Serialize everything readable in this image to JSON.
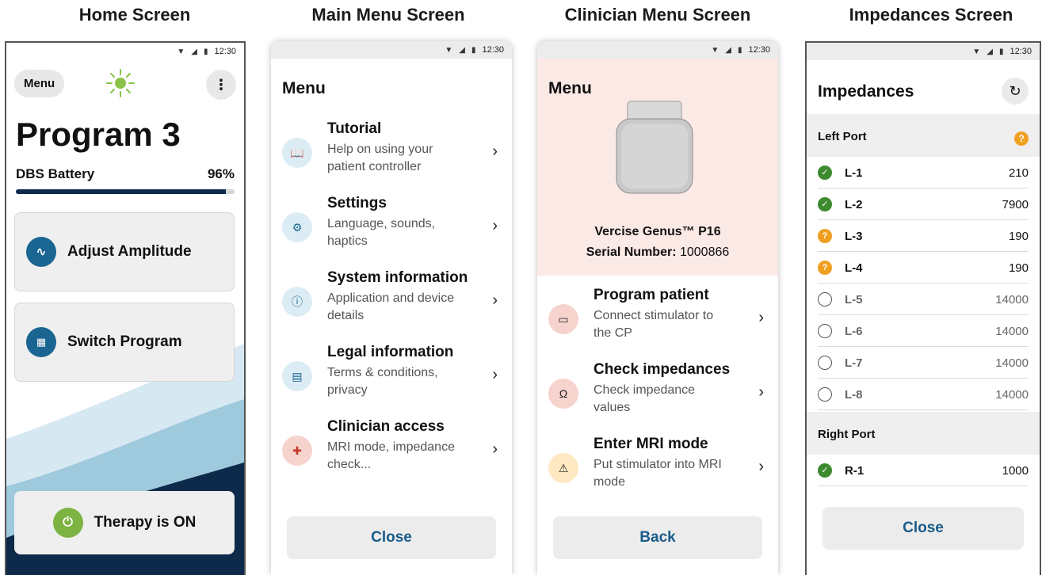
{
  "screen_titles": [
    "Home Screen",
    "Main Menu Screen",
    "Clinician Menu Screen",
    "Impedances Screen"
  ],
  "status_time": "12:30",
  "home": {
    "menu_button": "Menu",
    "kebab": "⋮",
    "program_name": "Program 3",
    "battery_label": "DBS Battery",
    "battery_percent": "96%",
    "battery_level": 0.96,
    "adjust_amplitude": "Adjust Amplitude",
    "switch_program": "Switch Program",
    "therapy_status": "Therapy is ON"
  },
  "main_menu": {
    "heading": "Menu",
    "items": [
      {
        "title": "Tutorial",
        "desc": "Help on using your patient controller",
        "icon": "book-icon"
      },
      {
        "title": "Settings",
        "desc": "Language, sounds, haptics",
        "icon": "gear-icon"
      },
      {
        "title": "System information",
        "desc": "Application and device details",
        "icon": "info-icon"
      },
      {
        "title": "Legal information",
        "desc": "Terms & conditions, privacy",
        "icon": "document-icon"
      },
      {
        "title": "Clinician access",
        "desc": "MRI mode, impedance check...",
        "icon": "medical-icon"
      }
    ],
    "close_label": "Close"
  },
  "clinician_menu": {
    "heading": "Menu",
    "device_name": "Vercise Genus™ P16",
    "serial_label": "Serial Number:",
    "serial_value": "1000866",
    "items": [
      {
        "title": "Program patient",
        "desc": "Connect stimulator to the CP",
        "icon": "laptop-icon"
      },
      {
        "title": "Check impedances",
        "desc": "Check impedance values",
        "icon": "impedance-icon"
      },
      {
        "title": "Enter MRI mode",
        "desc": "Put stimulator into MRI mode",
        "icon": "mri-warning-icon"
      }
    ],
    "back_label": "Back"
  },
  "impedances": {
    "title": "Impedances",
    "left_port": "Left Port",
    "right_port": "Right Port",
    "left_rows": [
      {
        "name": "L-1",
        "value": "210",
        "status": "ok"
      },
      {
        "name": "L-2",
        "value": "7900",
        "status": "ok"
      },
      {
        "name": "L-3",
        "value": "190",
        "status": "warn"
      },
      {
        "name": "L-4",
        "value": "190",
        "status": "warn"
      },
      {
        "name": "L-5",
        "value": "14000",
        "status": "none"
      },
      {
        "name": "L-6",
        "value": "14000",
        "status": "none"
      },
      {
        "name": "L-7",
        "value": "14000",
        "status": "none"
      },
      {
        "name": "L-8",
        "value": "14000",
        "status": "none"
      }
    ],
    "right_rows": [
      {
        "name": "R-1",
        "value": "1000",
        "status": "ok"
      }
    ],
    "close_label": "Close"
  },
  "colors": {
    "accent_blue": "#1a6592",
    "navy": "#0d2a4a",
    "therapy_green": "#7cb342",
    "ok_green": "#3e8a2f",
    "warn_orange": "#f0a020",
    "clinician_pink": "#fbe9e6"
  }
}
